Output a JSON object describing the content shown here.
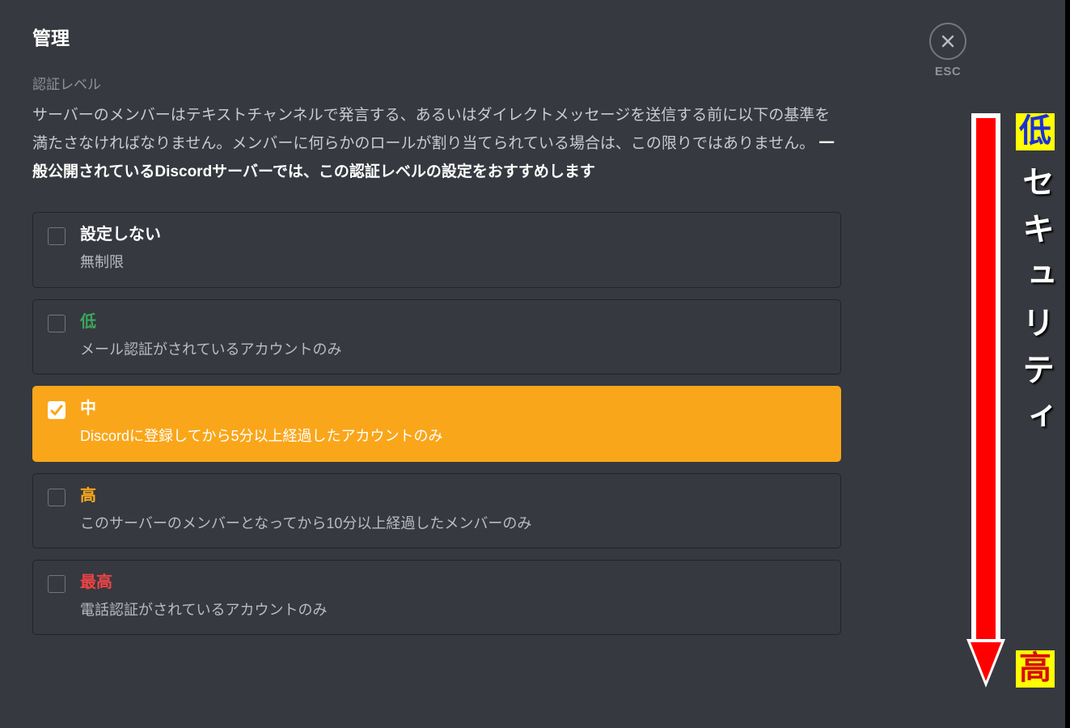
{
  "header": {
    "title": "管理",
    "close_label": "ESC"
  },
  "section": {
    "label": "認証レベル",
    "desc_pre": "サーバーのメンバーはテキストチャンネルで発言する、あるいはダイレクトメッセージを送信する前に以下の基準を満たさなければなりません。メンバーに何らかのロールが割り当てられている場合は、この限りではありません。 ",
    "desc_bold": "一般公開されているDiscordサーバーでは、この認証レベルの設定をおすすめします"
  },
  "options": [
    {
      "key": "none",
      "title": "設定しない",
      "desc": "無制限",
      "selected": false
    },
    {
      "key": "low",
      "title": "低",
      "desc": "メール認証がされているアカウントのみ",
      "selected": false
    },
    {
      "key": "mid",
      "title": "中",
      "desc": "Discordに登録してから5分以上経過したアカウントのみ",
      "selected": true
    },
    {
      "key": "high",
      "title": "高",
      "desc": "このサーバーのメンバーとなってから10分以上経過したメンバーのみ",
      "selected": false
    },
    {
      "key": "vhigh",
      "title": "最高",
      "desc": "電話認証がされているアカウントのみ",
      "selected": false
    }
  ],
  "annotation": {
    "top_badge": "低",
    "bottom_badge": "高",
    "vertical_label": "セキュリティ",
    "arrow_color": "#ff0000"
  }
}
